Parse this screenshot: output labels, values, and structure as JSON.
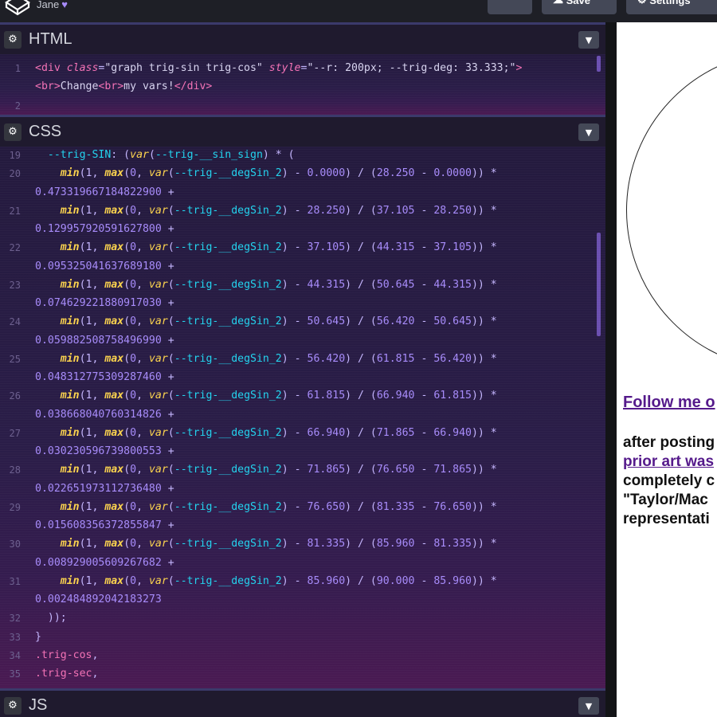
{
  "topbar": {
    "user": "Jane",
    "buttons": [
      "",
      "Save",
      "Settings"
    ]
  },
  "panels": {
    "html": {
      "title": "HTML"
    },
    "css": {
      "title": "CSS"
    },
    "js": {
      "title": "JS"
    }
  },
  "html_lines": [
    {
      "n": "1",
      "segs": [
        [
          "tag",
          "<div "
        ],
        [
          "attr",
          "class"
        ],
        [
          "op",
          "="
        ],
        [
          "str",
          "\"graph trig-sin trig-cos\" "
        ],
        [
          "attr",
          "style"
        ],
        [
          "op",
          "="
        ],
        [
          "str",
          "\"--r: 200px; --trig-deg: 33.333;\""
        ],
        [
          "tag",
          ">"
        ]
      ]
    },
    {
      "n": "",
      "segs": [
        [
          "tag",
          "<br>"
        ],
        [
          "str",
          "Change"
        ],
        [
          "tag",
          "<br>"
        ],
        [
          "str",
          "my vars!"
        ],
        [
          "tag",
          "</div>"
        ]
      ]
    },
    {
      "n": "2",
      "segs": []
    }
  ],
  "css_lines": [
    {
      "n": "19",
      "segs": [
        [
          "str",
          "  "
        ],
        [
          "prop",
          "--trig-SIN"
        ],
        [
          "op",
          ": ("
        ],
        [
          "fn",
          "var"
        ],
        [
          "op",
          "("
        ],
        [
          "prop",
          "--trig-__sin_sign"
        ],
        [
          "op",
          ") * ("
        ]
      ]
    },
    {
      "n": "20",
      "segs": [
        [
          "str",
          "    "
        ],
        [
          "kw",
          "min"
        ],
        [
          "op",
          "(1, "
        ],
        [
          "kw",
          "max"
        ],
        [
          "op",
          "("
        ],
        [
          "num",
          "0"
        ],
        [
          "op",
          ", "
        ],
        [
          "fn",
          "var"
        ],
        [
          "op",
          "("
        ],
        [
          "prop",
          "--trig-__degSin_2"
        ],
        [
          "op",
          ") - "
        ],
        [
          "num",
          "0.0000"
        ],
        [
          "op",
          ") / ("
        ],
        [
          "num",
          "28.250"
        ],
        [
          "op",
          " - "
        ],
        [
          "num",
          "0.0000"
        ],
        [
          "op",
          ")) *"
        ]
      ]
    },
    {
      "n": "",
      "segs": [
        [
          "num",
          "0.473319667184822900"
        ],
        [
          "op",
          " +"
        ]
      ]
    },
    {
      "n": "21",
      "segs": [
        [
          "str",
          "    "
        ],
        [
          "kw",
          "min"
        ],
        [
          "op",
          "(1, "
        ],
        [
          "kw",
          "max"
        ],
        [
          "op",
          "("
        ],
        [
          "num",
          "0"
        ],
        [
          "op",
          ", "
        ],
        [
          "fn",
          "var"
        ],
        [
          "op",
          "("
        ],
        [
          "prop",
          "--trig-__degSin_2"
        ],
        [
          "op",
          ") - "
        ],
        [
          "num",
          "28.250"
        ],
        [
          "op",
          ") / ("
        ],
        [
          "num",
          "37.105"
        ],
        [
          "op",
          " - "
        ],
        [
          "num",
          "28.250"
        ],
        [
          "op",
          ")) *"
        ]
      ]
    },
    {
      "n": "",
      "segs": [
        [
          "num",
          "0.129957920591627800"
        ],
        [
          "op",
          " +"
        ]
      ]
    },
    {
      "n": "22",
      "segs": [
        [
          "str",
          "    "
        ],
        [
          "kw",
          "min"
        ],
        [
          "op",
          "(1, "
        ],
        [
          "kw",
          "max"
        ],
        [
          "op",
          "("
        ],
        [
          "num",
          "0"
        ],
        [
          "op",
          ", "
        ],
        [
          "fn",
          "var"
        ],
        [
          "op",
          "("
        ],
        [
          "prop",
          "--trig-__degSin_2"
        ],
        [
          "op",
          ") - "
        ],
        [
          "num",
          "37.105"
        ],
        [
          "op",
          ") / ("
        ],
        [
          "num",
          "44.315"
        ],
        [
          "op",
          " - "
        ],
        [
          "num",
          "37.105"
        ],
        [
          "op",
          ")) *"
        ]
      ]
    },
    {
      "n": "",
      "segs": [
        [
          "num",
          "0.095325041637689180"
        ],
        [
          "op",
          " +"
        ]
      ]
    },
    {
      "n": "23",
      "segs": [
        [
          "str",
          "    "
        ],
        [
          "kw",
          "min"
        ],
        [
          "op",
          "(1, "
        ],
        [
          "kw",
          "max"
        ],
        [
          "op",
          "("
        ],
        [
          "num",
          "0"
        ],
        [
          "op",
          ", "
        ],
        [
          "fn",
          "var"
        ],
        [
          "op",
          "("
        ],
        [
          "prop",
          "--trig-__degSin_2"
        ],
        [
          "op",
          ") - "
        ],
        [
          "num",
          "44.315"
        ],
        [
          "op",
          ") / ("
        ],
        [
          "num",
          "50.645"
        ],
        [
          "op",
          " - "
        ],
        [
          "num",
          "44.315"
        ],
        [
          "op",
          ")) *"
        ]
      ]
    },
    {
      "n": "",
      "segs": [
        [
          "num",
          "0.074629221880917030"
        ],
        [
          "op",
          " +"
        ]
      ]
    },
    {
      "n": "24",
      "segs": [
        [
          "str",
          "    "
        ],
        [
          "kw",
          "min"
        ],
        [
          "op",
          "(1, "
        ],
        [
          "kw",
          "max"
        ],
        [
          "op",
          "("
        ],
        [
          "num",
          "0"
        ],
        [
          "op",
          ", "
        ],
        [
          "fn",
          "var"
        ],
        [
          "op",
          "("
        ],
        [
          "prop",
          "--trig-__degSin_2"
        ],
        [
          "op",
          ") - "
        ],
        [
          "num",
          "50.645"
        ],
        [
          "op",
          ") / ("
        ],
        [
          "num",
          "56.420"
        ],
        [
          "op",
          " - "
        ],
        [
          "num",
          "50.645"
        ],
        [
          "op",
          ")) *"
        ]
      ]
    },
    {
      "n": "",
      "segs": [
        [
          "num",
          "0.059882508758496990"
        ],
        [
          "op",
          " +"
        ]
      ]
    },
    {
      "n": "25",
      "segs": [
        [
          "str",
          "    "
        ],
        [
          "kw",
          "min"
        ],
        [
          "op",
          "(1, "
        ],
        [
          "kw",
          "max"
        ],
        [
          "op",
          "("
        ],
        [
          "num",
          "0"
        ],
        [
          "op",
          ", "
        ],
        [
          "fn",
          "var"
        ],
        [
          "op",
          "("
        ],
        [
          "prop",
          "--trig-__degSin_2"
        ],
        [
          "op",
          ") - "
        ],
        [
          "num",
          "56.420"
        ],
        [
          "op",
          ") / ("
        ],
        [
          "num",
          "61.815"
        ],
        [
          "op",
          " - "
        ],
        [
          "num",
          "56.420"
        ],
        [
          "op",
          ")) *"
        ]
      ]
    },
    {
      "n": "",
      "segs": [
        [
          "num",
          "0.048312775309287460"
        ],
        [
          "op",
          " +"
        ]
      ]
    },
    {
      "n": "26",
      "segs": [
        [
          "str",
          "    "
        ],
        [
          "kw",
          "min"
        ],
        [
          "op",
          "(1, "
        ],
        [
          "kw",
          "max"
        ],
        [
          "op",
          "("
        ],
        [
          "num",
          "0"
        ],
        [
          "op",
          ", "
        ],
        [
          "fn",
          "var"
        ],
        [
          "op",
          "("
        ],
        [
          "prop",
          "--trig-__degSin_2"
        ],
        [
          "op",
          ") - "
        ],
        [
          "num",
          "61.815"
        ],
        [
          "op",
          ") / ("
        ],
        [
          "num",
          "66.940"
        ],
        [
          "op",
          " - "
        ],
        [
          "num",
          "61.815"
        ],
        [
          "op",
          ")) *"
        ]
      ]
    },
    {
      "n": "",
      "segs": [
        [
          "num",
          "0.038668040760314826"
        ],
        [
          "op",
          " +"
        ]
      ]
    },
    {
      "n": "27",
      "segs": [
        [
          "str",
          "    "
        ],
        [
          "kw",
          "min"
        ],
        [
          "op",
          "(1, "
        ],
        [
          "kw",
          "max"
        ],
        [
          "op",
          "("
        ],
        [
          "num",
          "0"
        ],
        [
          "op",
          ", "
        ],
        [
          "fn",
          "var"
        ],
        [
          "op",
          "("
        ],
        [
          "prop",
          "--trig-__degSin_2"
        ],
        [
          "op",
          ") - "
        ],
        [
          "num",
          "66.940"
        ],
        [
          "op",
          ") / ("
        ],
        [
          "num",
          "71.865"
        ],
        [
          "op",
          " - "
        ],
        [
          "num",
          "66.940"
        ],
        [
          "op",
          ")) *"
        ]
      ]
    },
    {
      "n": "",
      "segs": [
        [
          "num",
          "0.030230596739800553"
        ],
        [
          "op",
          " +"
        ]
      ]
    },
    {
      "n": "28",
      "segs": [
        [
          "str",
          "    "
        ],
        [
          "kw",
          "min"
        ],
        [
          "op",
          "(1, "
        ],
        [
          "kw",
          "max"
        ],
        [
          "op",
          "("
        ],
        [
          "num",
          "0"
        ],
        [
          "op",
          ", "
        ],
        [
          "fn",
          "var"
        ],
        [
          "op",
          "("
        ],
        [
          "prop",
          "--trig-__degSin_2"
        ],
        [
          "op",
          ") - "
        ],
        [
          "num",
          "71.865"
        ],
        [
          "op",
          ") / ("
        ],
        [
          "num",
          "76.650"
        ],
        [
          "op",
          " - "
        ],
        [
          "num",
          "71.865"
        ],
        [
          "op",
          ")) *"
        ]
      ]
    },
    {
      "n": "",
      "segs": [
        [
          "num",
          "0.022651973112736480"
        ],
        [
          "op",
          " +"
        ]
      ]
    },
    {
      "n": "29",
      "segs": [
        [
          "str",
          "    "
        ],
        [
          "kw",
          "min"
        ],
        [
          "op",
          "(1, "
        ],
        [
          "kw",
          "max"
        ],
        [
          "op",
          "("
        ],
        [
          "num",
          "0"
        ],
        [
          "op",
          ", "
        ],
        [
          "fn",
          "var"
        ],
        [
          "op",
          "("
        ],
        [
          "prop",
          "--trig-__degSin_2"
        ],
        [
          "op",
          ") - "
        ],
        [
          "num",
          "76.650"
        ],
        [
          "op",
          ") / ("
        ],
        [
          "num",
          "81.335"
        ],
        [
          "op",
          " - "
        ],
        [
          "num",
          "76.650"
        ],
        [
          "op",
          ")) *"
        ]
      ]
    },
    {
      "n": "",
      "segs": [
        [
          "num",
          "0.015608356372855847"
        ],
        [
          "op",
          " +"
        ]
      ]
    },
    {
      "n": "30",
      "segs": [
        [
          "str",
          "    "
        ],
        [
          "kw",
          "min"
        ],
        [
          "op",
          "(1, "
        ],
        [
          "kw",
          "max"
        ],
        [
          "op",
          "("
        ],
        [
          "num",
          "0"
        ],
        [
          "op",
          ", "
        ],
        [
          "fn",
          "var"
        ],
        [
          "op",
          "("
        ],
        [
          "prop",
          "--trig-__degSin_2"
        ],
        [
          "op",
          ") - "
        ],
        [
          "num",
          "81.335"
        ],
        [
          "op",
          ") / ("
        ],
        [
          "num",
          "85.960"
        ],
        [
          "op",
          " - "
        ],
        [
          "num",
          "81.335"
        ],
        [
          "op",
          ")) *"
        ]
      ]
    },
    {
      "n": "",
      "segs": [
        [
          "num",
          "0.008929005609267682"
        ],
        [
          "op",
          " +"
        ]
      ]
    },
    {
      "n": "31",
      "segs": [
        [
          "str",
          "    "
        ],
        [
          "kw",
          "min"
        ],
        [
          "op",
          "(1, "
        ],
        [
          "kw",
          "max"
        ],
        [
          "op",
          "("
        ],
        [
          "num",
          "0"
        ],
        [
          "op",
          ", "
        ],
        [
          "fn",
          "var"
        ],
        [
          "op",
          "("
        ],
        [
          "prop",
          "--trig-__degSin_2"
        ],
        [
          "op",
          ") - "
        ],
        [
          "num",
          "85.960"
        ],
        [
          "op",
          ") / ("
        ],
        [
          "num",
          "90.000"
        ],
        [
          "op",
          " - "
        ],
        [
          "num",
          "85.960"
        ],
        [
          "op",
          ")) *"
        ]
      ]
    },
    {
      "n": "",
      "segs": [
        [
          "num",
          "0.002484892042183273"
        ]
      ]
    },
    {
      "n": "32",
      "segs": [
        [
          "op",
          "  ));"
        ]
      ]
    },
    {
      "n": "33",
      "segs": [
        [
          "op",
          "}"
        ]
      ]
    },
    {
      "n": "34",
      "segs": [
        [
          "sel",
          ".trig-cos"
        ],
        [
          "op",
          ","
        ]
      ]
    },
    {
      "n": "35",
      "segs": [
        [
          "sel",
          ".trig-sec"
        ],
        [
          "op",
          ","
        ]
      ]
    }
  ],
  "preview": {
    "link": "Follow me o",
    "lines": [
      {
        "text": "after posting",
        "link": false
      },
      {
        "text": "prior art was",
        "link": true
      },
      {
        "text": "completely c",
        "link": false
      },
      {
        "text": "\"Taylor/Mac",
        "link": false
      },
      {
        "text": "representati",
        "link": false
      }
    ]
  }
}
